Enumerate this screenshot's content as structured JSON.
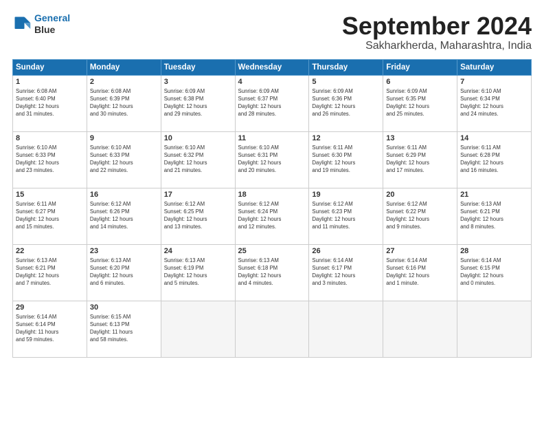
{
  "logo": {
    "line1": "General",
    "line2": "Blue"
  },
  "title": "September 2024",
  "subtitle": "Sakharkherda, Maharashtra, India",
  "days_header": [
    "Sunday",
    "Monday",
    "Tuesday",
    "Wednesday",
    "Thursday",
    "Friday",
    "Saturday"
  ],
  "weeks": [
    [
      {
        "num": "1",
        "info": "Sunrise: 6:08 AM\nSunset: 6:40 PM\nDaylight: 12 hours\nand 31 minutes."
      },
      {
        "num": "2",
        "info": "Sunrise: 6:08 AM\nSunset: 6:39 PM\nDaylight: 12 hours\nand 30 minutes."
      },
      {
        "num": "3",
        "info": "Sunrise: 6:09 AM\nSunset: 6:38 PM\nDaylight: 12 hours\nand 29 minutes."
      },
      {
        "num": "4",
        "info": "Sunrise: 6:09 AM\nSunset: 6:37 PM\nDaylight: 12 hours\nand 28 minutes."
      },
      {
        "num": "5",
        "info": "Sunrise: 6:09 AM\nSunset: 6:36 PM\nDaylight: 12 hours\nand 26 minutes."
      },
      {
        "num": "6",
        "info": "Sunrise: 6:09 AM\nSunset: 6:35 PM\nDaylight: 12 hours\nand 25 minutes."
      },
      {
        "num": "7",
        "info": "Sunrise: 6:10 AM\nSunset: 6:34 PM\nDaylight: 12 hours\nand 24 minutes."
      }
    ],
    [
      {
        "num": "8",
        "info": "Sunrise: 6:10 AM\nSunset: 6:33 PM\nDaylight: 12 hours\nand 23 minutes."
      },
      {
        "num": "9",
        "info": "Sunrise: 6:10 AM\nSunset: 6:33 PM\nDaylight: 12 hours\nand 22 minutes."
      },
      {
        "num": "10",
        "info": "Sunrise: 6:10 AM\nSunset: 6:32 PM\nDaylight: 12 hours\nand 21 minutes."
      },
      {
        "num": "11",
        "info": "Sunrise: 6:10 AM\nSunset: 6:31 PM\nDaylight: 12 hours\nand 20 minutes."
      },
      {
        "num": "12",
        "info": "Sunrise: 6:11 AM\nSunset: 6:30 PM\nDaylight: 12 hours\nand 19 minutes."
      },
      {
        "num": "13",
        "info": "Sunrise: 6:11 AM\nSunset: 6:29 PM\nDaylight: 12 hours\nand 17 minutes."
      },
      {
        "num": "14",
        "info": "Sunrise: 6:11 AM\nSunset: 6:28 PM\nDaylight: 12 hours\nand 16 minutes."
      }
    ],
    [
      {
        "num": "15",
        "info": "Sunrise: 6:11 AM\nSunset: 6:27 PM\nDaylight: 12 hours\nand 15 minutes."
      },
      {
        "num": "16",
        "info": "Sunrise: 6:12 AM\nSunset: 6:26 PM\nDaylight: 12 hours\nand 14 minutes."
      },
      {
        "num": "17",
        "info": "Sunrise: 6:12 AM\nSunset: 6:25 PM\nDaylight: 12 hours\nand 13 minutes."
      },
      {
        "num": "18",
        "info": "Sunrise: 6:12 AM\nSunset: 6:24 PM\nDaylight: 12 hours\nand 12 minutes."
      },
      {
        "num": "19",
        "info": "Sunrise: 6:12 AM\nSunset: 6:23 PM\nDaylight: 12 hours\nand 11 minutes."
      },
      {
        "num": "20",
        "info": "Sunrise: 6:12 AM\nSunset: 6:22 PM\nDaylight: 12 hours\nand 9 minutes."
      },
      {
        "num": "21",
        "info": "Sunrise: 6:13 AM\nSunset: 6:21 PM\nDaylight: 12 hours\nand 8 minutes."
      }
    ],
    [
      {
        "num": "22",
        "info": "Sunrise: 6:13 AM\nSunset: 6:21 PM\nDaylight: 12 hours\nand 7 minutes."
      },
      {
        "num": "23",
        "info": "Sunrise: 6:13 AM\nSunset: 6:20 PM\nDaylight: 12 hours\nand 6 minutes."
      },
      {
        "num": "24",
        "info": "Sunrise: 6:13 AM\nSunset: 6:19 PM\nDaylight: 12 hours\nand 5 minutes."
      },
      {
        "num": "25",
        "info": "Sunrise: 6:13 AM\nSunset: 6:18 PM\nDaylight: 12 hours\nand 4 minutes."
      },
      {
        "num": "26",
        "info": "Sunrise: 6:14 AM\nSunset: 6:17 PM\nDaylight: 12 hours\nand 3 minutes."
      },
      {
        "num": "27",
        "info": "Sunrise: 6:14 AM\nSunset: 6:16 PM\nDaylight: 12 hours\nand 1 minute."
      },
      {
        "num": "28",
        "info": "Sunrise: 6:14 AM\nSunset: 6:15 PM\nDaylight: 12 hours\nand 0 minutes."
      }
    ],
    [
      {
        "num": "29",
        "info": "Sunrise: 6:14 AM\nSunset: 6:14 PM\nDaylight: 11 hours\nand 59 minutes."
      },
      {
        "num": "30",
        "info": "Sunrise: 6:15 AM\nSunset: 6:13 PM\nDaylight: 11 hours\nand 58 minutes."
      },
      {
        "num": "",
        "info": ""
      },
      {
        "num": "",
        "info": ""
      },
      {
        "num": "",
        "info": ""
      },
      {
        "num": "",
        "info": ""
      },
      {
        "num": "",
        "info": ""
      }
    ]
  ]
}
